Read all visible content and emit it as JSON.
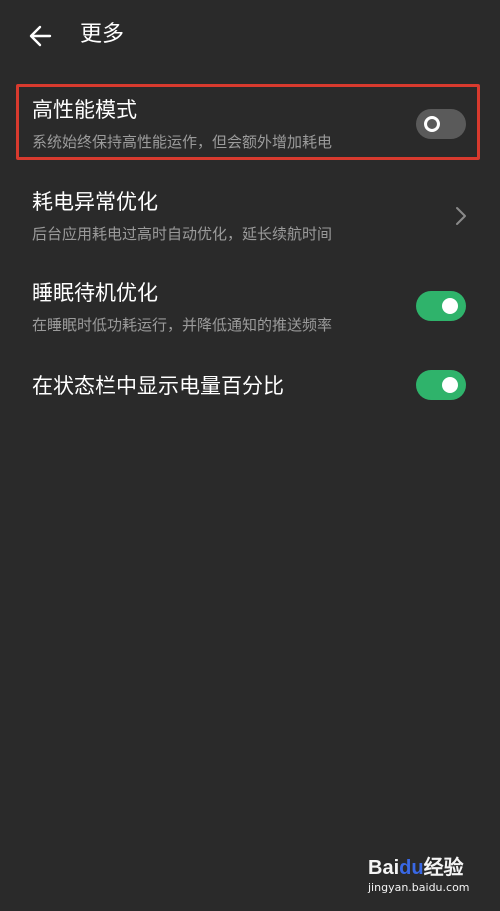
{
  "header": {
    "back_icon": "arrow-left-icon",
    "title": "更多"
  },
  "settings": [
    {
      "title": "高性能模式",
      "subtitle": "系统始终保持高性能运作，但会额外增加耗电",
      "control": "toggle",
      "state": "off",
      "highlighted": true
    },
    {
      "title": "耗电异常优化",
      "subtitle": "后台应用耗电过高时自动优化，延长续航时间",
      "control": "chevron",
      "icon": "chevron-right-icon"
    },
    {
      "title": "睡眠待机优化",
      "subtitle": "在睡眠时低功耗运行，并降低通知的推送频率",
      "control": "toggle",
      "state": "on"
    },
    {
      "title": "在状态栏中显示电量百分比",
      "control": "toggle",
      "state": "on"
    }
  ],
  "colors": {
    "background": "#2a2a2a",
    "toggle_on": "#2fb36b",
    "toggle_off": "#5a5a5a",
    "highlight": "#d83a2e",
    "subtitle": "#9b9b9b"
  },
  "watermark": {
    "logo_prefix": "Bai",
    "logo_du": "du",
    "logo_suffix": "经验",
    "url": "jingyan.baidu.com"
  }
}
